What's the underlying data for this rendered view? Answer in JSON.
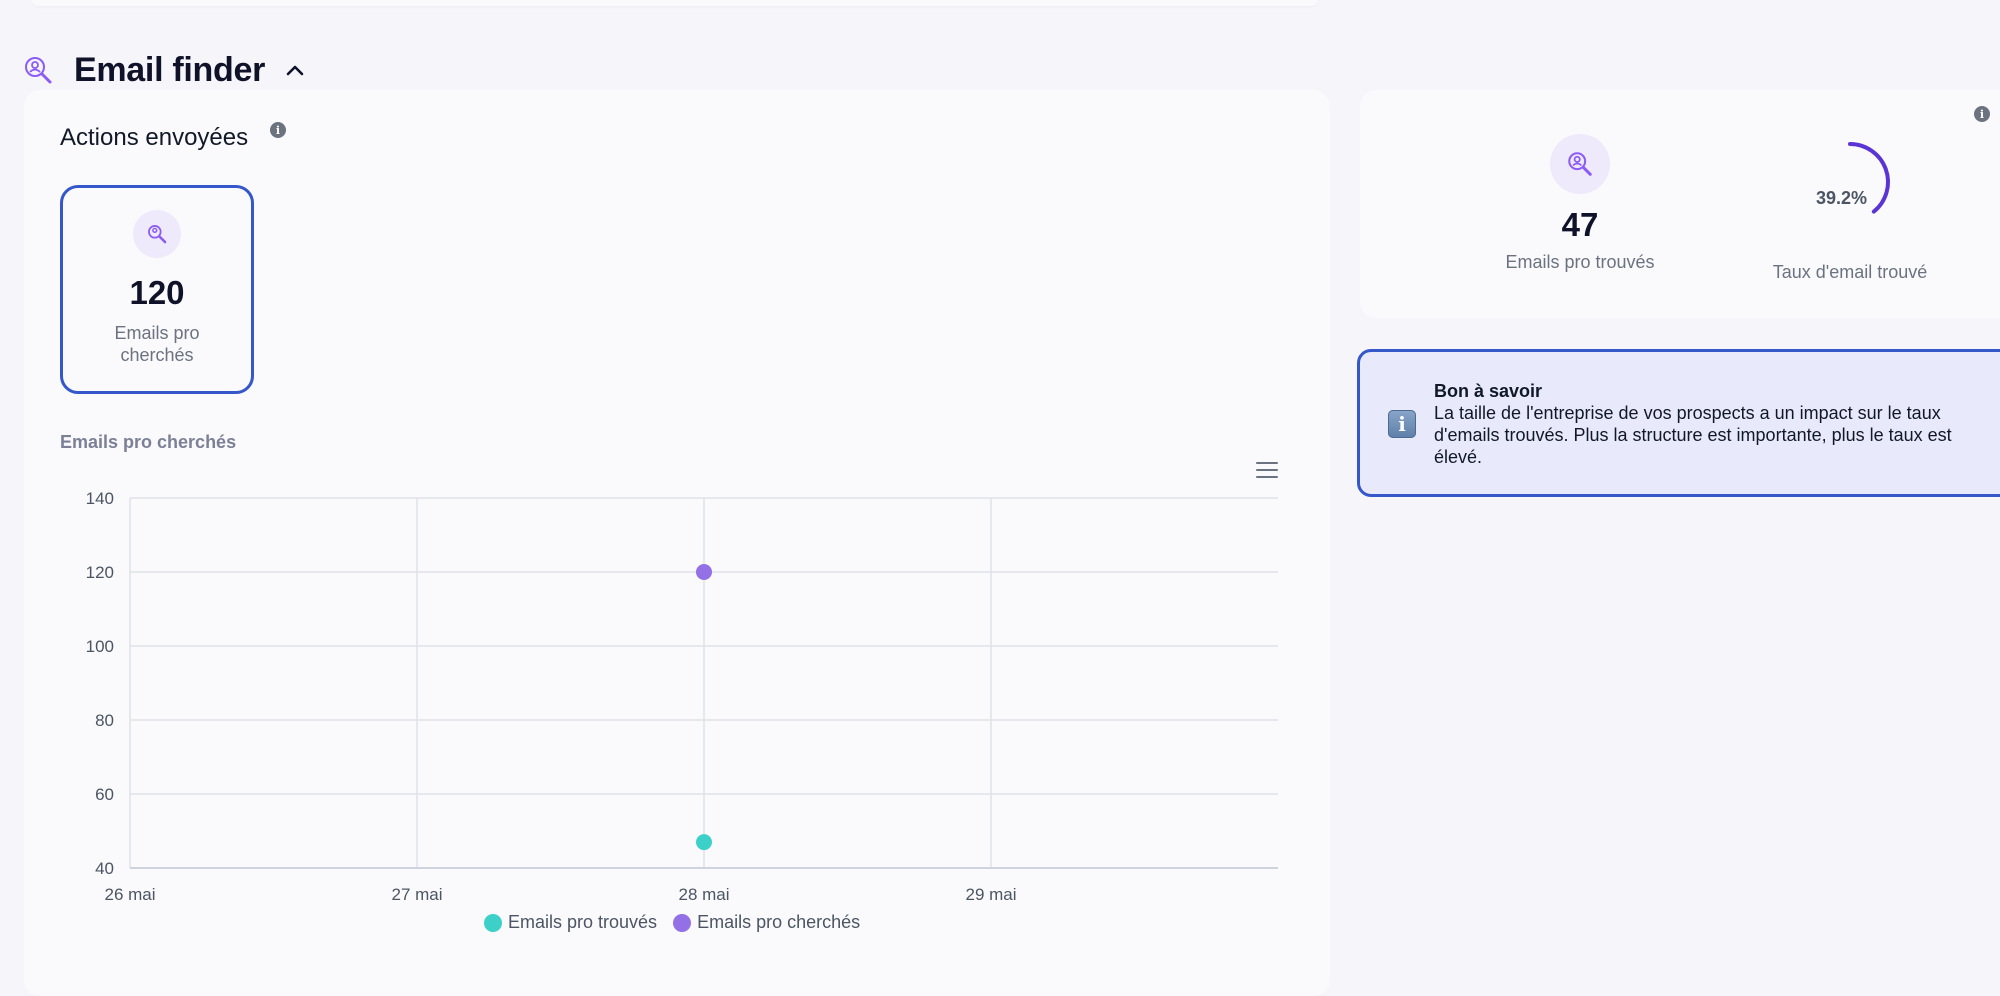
{
  "section": {
    "title": "Email finder"
  },
  "actions": {
    "title": "Actions envoyées",
    "card": {
      "value": "120",
      "label": "Emails pro cherchés"
    }
  },
  "stats": {
    "found": {
      "value": "47",
      "label": "Emails pro trouvés"
    },
    "rate": {
      "value": "39.2%",
      "label": "Taux d'email trouvé",
      "fraction": 0.392
    }
  },
  "notice": {
    "title": "Bon à savoir",
    "text": "La taille de l'entreprise de vos prospects a un impact sur le taux d'emails trouvés. Plus la structure est importante, plus le taux est élevé."
  },
  "colors": {
    "accent": "#3557c9",
    "purple": "#9370e6",
    "teal": "#3cd0c8",
    "gauge": "#5b34d6"
  },
  "chart_data": {
    "type": "scatter",
    "title": "Emails pro cherchés",
    "x_categories": [
      "26 mai",
      "27 mai",
      "28 mai",
      "29 mai"
    ],
    "ylim": [
      40,
      140
    ],
    "y_ticks": [
      140,
      120,
      100,
      80,
      60,
      40
    ],
    "grid": true,
    "legend_position": "bottom",
    "series": [
      {
        "name": "Emails pro trouvés",
        "color": "#3cd0c8",
        "points": [
          {
            "x": "28 mai",
            "y": 47
          }
        ]
      },
      {
        "name": "Emails pro cherchés",
        "color": "#9370e6",
        "points": [
          {
            "x": "28 mai",
            "y": 120
          }
        ]
      }
    ]
  }
}
